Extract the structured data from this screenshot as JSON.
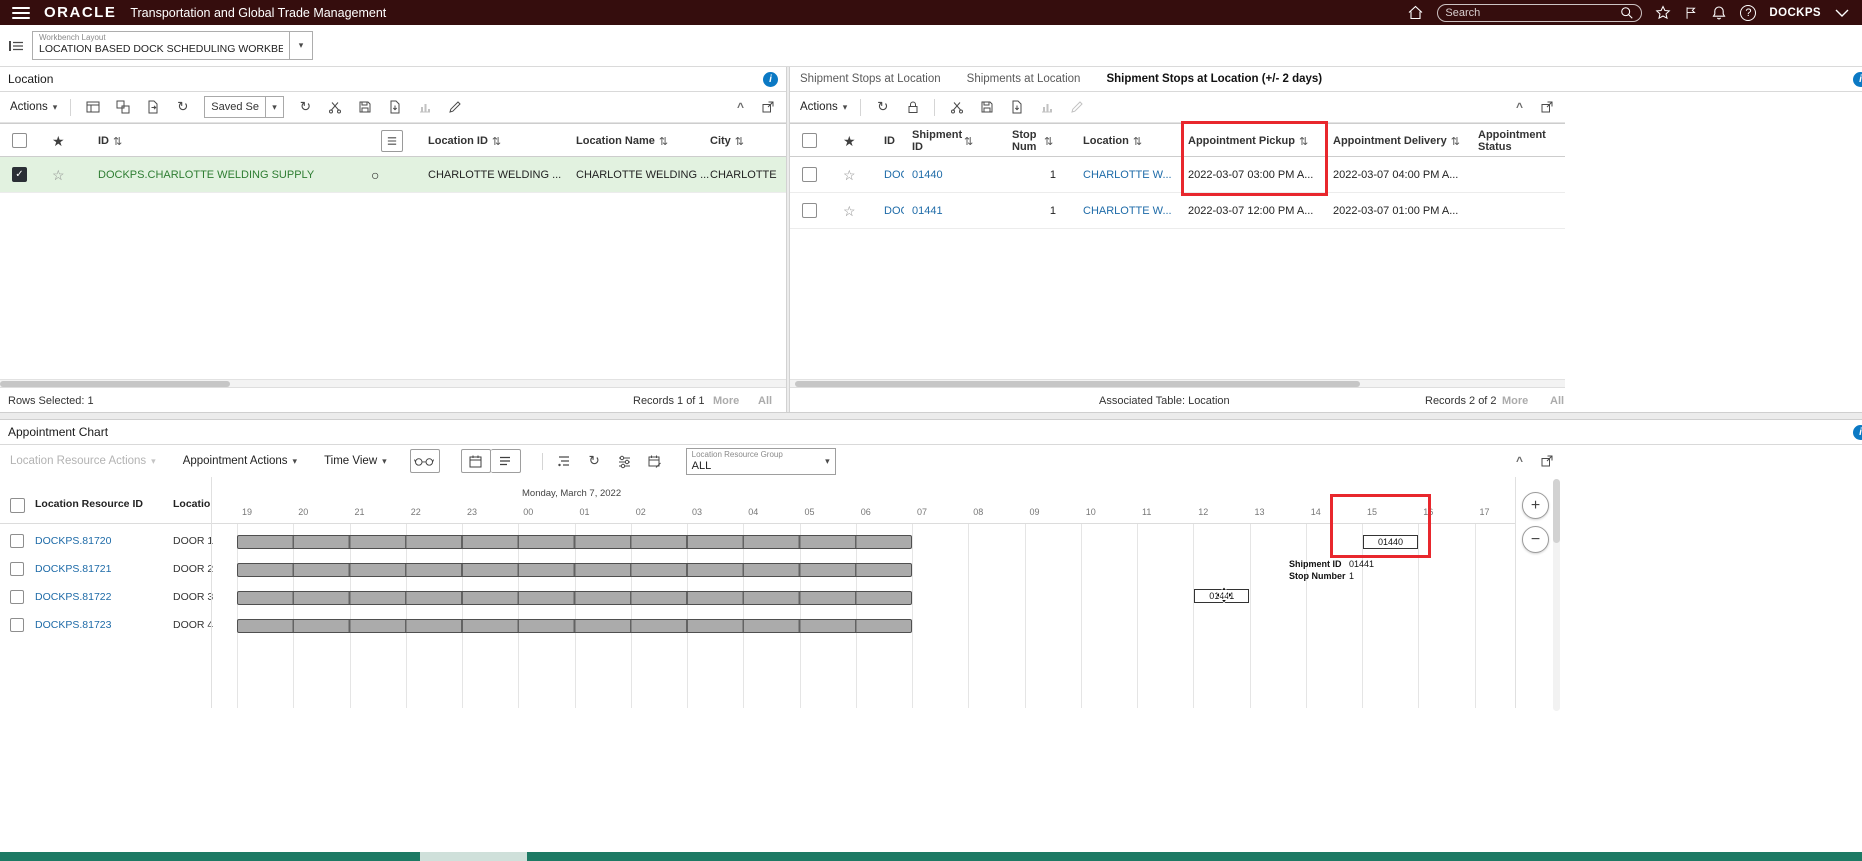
{
  "colors": {
    "topbar_bg": "#350d0d",
    "link_blue": "#1e6ba8",
    "selected_text_green": "#2e7d32",
    "selected_row_bg": "#e2f2e0",
    "annotation_red": "#e8272d",
    "info_icon_blue": "#0b79c4",
    "bottom_strip_green": "#1d7a64",
    "gantt_bar_gray": "#ababab"
  },
  "icons": {
    "caret_down": "▾",
    "refresh": "↻",
    "sort": "⇅",
    "star_filled": "★",
    "star_outline": "☆",
    "check": "✓",
    "status_circle": "○",
    "collapse": "^",
    "help": "?",
    "info": "i",
    "zoom_in": "+",
    "zoom_out": "−"
  },
  "topbar": {
    "logo": "ORACLE",
    "title": "Transportation and Global Trade Management",
    "search_placeholder": "Search",
    "user": "DOCKPS"
  },
  "workbench": {
    "label": "Workbench Layout",
    "value": "LOCATION BASED DOCK SCHEDULING WORKBE"
  },
  "left_panel": {
    "title": "Location",
    "toolbar": {
      "actions": "Actions",
      "saved_search": "Saved Se"
    },
    "columns": {
      "id": "ID",
      "location_id": "Location ID",
      "location_name": "Location Name",
      "city": "City"
    },
    "row": {
      "id": "DOCKPS.CHARLOTTE WELDING SUPPLY",
      "location_id": "CHARLOTTE WELDING ...",
      "location_name": "CHARLOTTE WELDING ...",
      "city": "CHARLOTTE"
    },
    "footer": {
      "rows_selected": "Rows Selected: 1",
      "records": "Records 1 of 1",
      "more": "More",
      "all": "All"
    }
  },
  "right_panel": {
    "tabs": [
      "Shipment Stops at Location",
      "Shipments at Location",
      "Shipment Stops at Location (+/- 2 days)"
    ],
    "toolbar": {
      "actions": "Actions"
    },
    "columns": {
      "id": "ID",
      "shipment_id": "Shipment ID",
      "stop_num": "Stop Num",
      "location": "Location",
      "appt_pickup": "Appointment Pickup",
      "appt_delivery": "Appointment Delivery",
      "appt_status": "Appointment Status"
    },
    "rows": [
      {
        "id": "DOC",
        "shipment_id": "01440",
        "stop_num": "1",
        "location": "CHARLOTTE W...",
        "appt_pickup": "2022-03-07 03:00 PM A...",
        "appt_delivery": "2022-03-07 04:00 PM A...",
        "appt_status": ""
      },
      {
        "id": "DOC",
        "shipment_id": "01441",
        "stop_num": "1",
        "location": "CHARLOTTE W...",
        "appt_pickup": "2022-03-07 12:00 PM A...",
        "appt_delivery": "2022-03-07 01:00 PM A...",
        "appt_status": ""
      }
    ],
    "footer": {
      "associated": "Associated Table: Location",
      "records": "Records 2 of 2",
      "more": "More",
      "all": "All"
    }
  },
  "bottom_panel": {
    "title": "Appointment Chart",
    "toolbar": {
      "location_resource_actions": "Location Resource Actions",
      "appointment_actions": "Appointment Actions",
      "time_view": "Time View",
      "group_label": "Location Resource Group",
      "group_value": "ALL"
    },
    "gantt": {
      "columns": {
        "resource": "Location Resource ID",
        "location": "Locatio"
      },
      "date_label": "Monday, March 7, 2022",
      "hours": [
        "19",
        "20",
        "21",
        "22",
        "23",
        "00",
        "01",
        "02",
        "03",
        "04",
        "05",
        "06",
        "07",
        "08",
        "09",
        "10",
        "11",
        "12",
        "13",
        "14",
        "15",
        "16",
        "17"
      ],
      "rows": [
        {
          "resource_id": "DOCKPS.81720",
          "location": "DOOR 1"
        },
        {
          "resource_id": "DOCKPS.81721",
          "location": "DOOR 2"
        },
        {
          "resource_id": "DOCKPS.81722",
          "location": "DOOR 3"
        },
        {
          "resource_id": "DOCKPS.81723",
          "location": "DOOR 4"
        }
      ],
      "unavailable_span": {
        "start_hour": "19",
        "end_hour": "07"
      },
      "appointment": {
        "label": "01440",
        "resource": "DOCKPS.81720",
        "hour": "15"
      },
      "drag_appointment": {
        "label": "01441",
        "resource": "DOCKPS.81722",
        "hour": "12"
      },
      "tooltip": {
        "shipment_label": "Shipment ID",
        "shipment_value": "01441",
        "stop_label": "Stop Number",
        "stop_value": "1"
      }
    }
  }
}
